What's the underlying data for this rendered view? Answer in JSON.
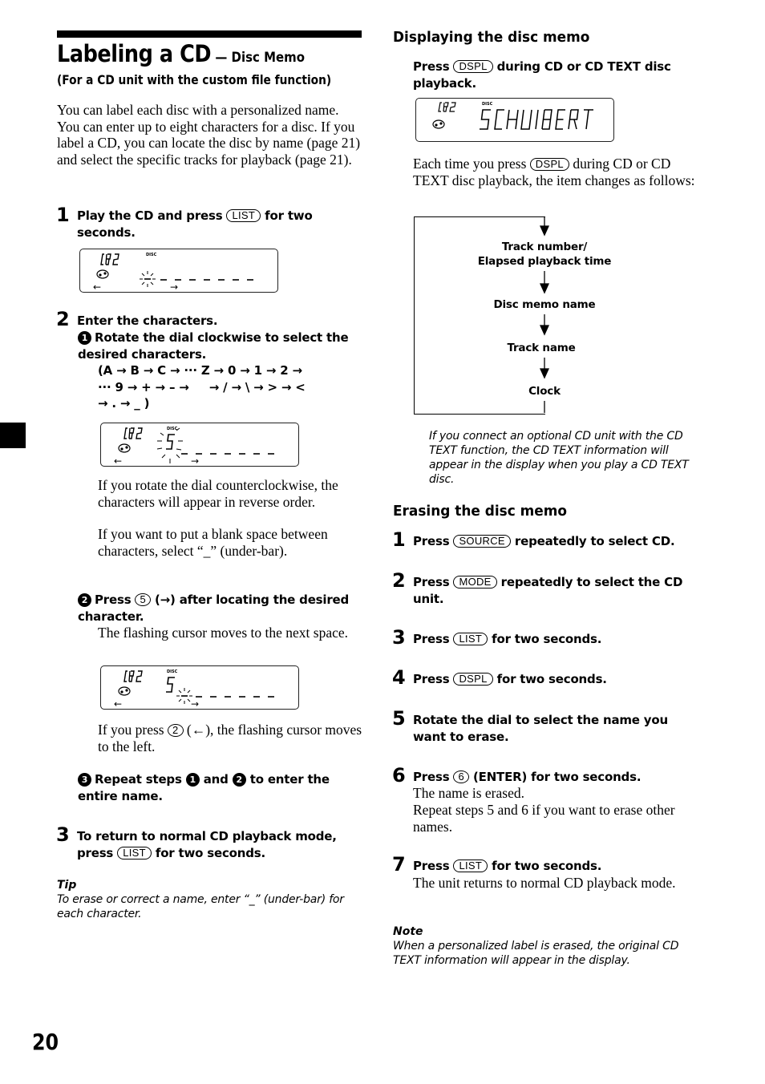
{
  "page": {
    "number": "20",
    "side_tab": "black-square"
  },
  "title": {
    "main": "Labeling a CD",
    "dash_sub": " — Disc Memo",
    "subtitle": "(For a CD unit with the custom file function)"
  },
  "intro": "You can label each disc with a personalized name. You can enter up to eight characters for a disc. If you label a CD, you can locate the disc by name (page 21) and select the specific tracks for playback (page 21).",
  "left_steps": {
    "step1": {
      "number": "1",
      "pre": "Play the CD and press ",
      "key": "LIST",
      "post": " for two seconds."
    },
    "step2": {
      "number": "2",
      "heading": "Enter the characters.",
      "sub1": {
        "marker": "1",
        "text": "Rotate the dial clockwise to select the desired characters.",
        "sequence_line1": "(A → B → C → ··· Z → 0 → 1 → 2 →",
        "sequence_line2": "··· 9 → + → – →     → / → \\ → > → <",
        "sequence_line3": "→ . → _ )",
        "note1": "If you rotate the dial counterclockwise, the characters will appear in reverse order.",
        "note2": "If you want to put a blank space between characters, select “_” (under-bar)."
      },
      "sub2": {
        "marker": "2",
        "pre": "Press ",
        "key": "5",
        "post": " (→) after locating the desired character.",
        "desc": "The flashing cursor moves to the next space.",
        "note_pre": "If you press ",
        "note_key": "2",
        "note_post": " (←), the flashing cursor moves to the left."
      },
      "sub3": {
        "marker": "3",
        "pre": "Repeat steps ",
        "ref1": "1",
        "mid": " and ",
        "ref2": "2",
        "post": " to enter the entire name."
      }
    },
    "step3": {
      "number": "3",
      "pre": "To return to normal CD playback mode, press ",
      "key": "LIST",
      "post": " for two seconds."
    },
    "tip": {
      "heading": "Tip",
      "text": "To erase or correct a name, enter “_” (under-bar) for each character."
    }
  },
  "displays": {
    "unit_label": "CD2",
    "disc_indicator": "DISC",
    "left_arrow": "←",
    "right_arrow": "→",
    "memo_name": "SCHUBERT",
    "entered_char": "S"
  },
  "display_section": {
    "heading": "Displaying the disc memo",
    "instr_pre": "Press ",
    "instr_key": "DSPL",
    "instr_post": " during CD or CD TEXT disc playback.",
    "each_pre": "Each time you press ",
    "each_key": "DSPL",
    "each_post": " during CD or CD TEXT disc playback, the item changes as follows:",
    "flow": [
      "Track number/\nElapsed playback time",
      "Disc memo name",
      "Track name",
      "Clock"
    ],
    "note": "If you connect an optional CD unit with the CD TEXT function, the CD TEXT information will appear in the display when you play a CD TEXT disc."
  },
  "erase_section": {
    "heading": "Erasing the disc memo",
    "steps": [
      {
        "number": "1",
        "pre": "Press ",
        "key": "SOURCE",
        "post": " repeatedly to select CD."
      },
      {
        "number": "2",
        "pre": "Press ",
        "key": "MODE",
        "post": " repeatedly to select the CD unit."
      },
      {
        "number": "3",
        "pre": "Press ",
        "key": "LIST",
        "post": " for two seconds."
      },
      {
        "number": "4",
        "pre": "Press ",
        "key": "DSPL",
        "post": " for two seconds."
      },
      {
        "number": "5",
        "pre": "Rotate the dial to select the name you want to erase.",
        "key": "",
        "post": ""
      },
      {
        "number": "6",
        "pre": "Press ",
        "key": "6",
        "post": " (ENTER) for two seconds.",
        "desc1": "The name is erased.",
        "desc2": "Repeat steps 5 and 6 if you want to erase other names."
      },
      {
        "number": "7",
        "pre": "Press ",
        "key": "LIST",
        "post": " for two seconds.",
        "desc1": "The unit returns to normal CD playback mode."
      }
    ],
    "note": {
      "heading": "Note",
      "text": "When a personalized label is erased, the original CD TEXT information will appear in the display."
    }
  }
}
